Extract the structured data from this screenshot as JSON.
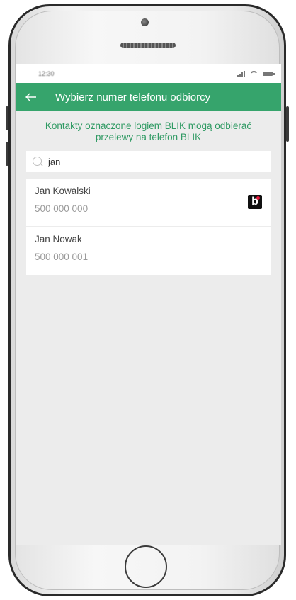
{
  "status": {
    "time": "12:30"
  },
  "header": {
    "title": "Wybierz numer telefonu odbiorcy",
    "back_icon": "arrow-left-icon"
  },
  "info": {
    "text": "Kontakty oznaczone logiem BLIK mogą odbierać przelewy na telefon BLIK"
  },
  "search": {
    "value": "jan",
    "icon": "search-icon"
  },
  "contacts": [
    {
      "name": "Jan Kowalski",
      "phone": "500 000 000",
      "blik": true
    },
    {
      "name": "Jan Nowak",
      "phone": "500 000 001",
      "blik": false
    }
  ],
  "colors": {
    "accent": "#36a46c",
    "info_text": "#2f9a63",
    "background": "#ececec"
  }
}
